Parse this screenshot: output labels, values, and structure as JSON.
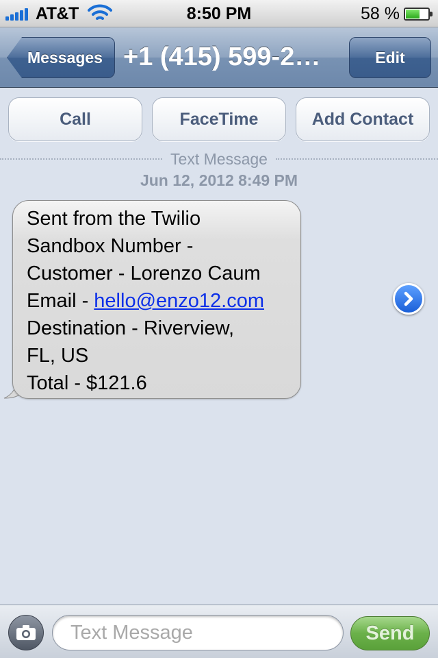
{
  "status_bar": {
    "carrier": "AT&T",
    "time": "8:50 PM",
    "battery_percent": "58 %",
    "battery_level": 0.58
  },
  "nav": {
    "back_label": "Messages",
    "title": "+1 (415) 599-2…",
    "edit_label": "Edit"
  },
  "actions": {
    "call": "Call",
    "facetime": "FaceTime",
    "add_contact": "Add Contact"
  },
  "conversation": {
    "divider_label": "Text Message",
    "timestamp": "Jun 12, 2012 8:49 PM"
  },
  "message": {
    "line1": "Sent from the Twilio",
    "line2": "Sandbox Number -",
    "line3": "Customer - Lorenzo Caum",
    "line4_prefix": "Email - ",
    "email": "hello@enzo12.com",
    "line5": "Destination - Riverview,",
    "line6": "FL, US",
    "line7": "Total - $121.6"
  },
  "input_bar": {
    "placeholder": "Text Message",
    "send_label": "Send"
  },
  "colors": {
    "background": "#dbe2ed",
    "link": "#0b2fe8",
    "send_green": "#6bb14a",
    "signal_blue": "#1a6fd6"
  }
}
